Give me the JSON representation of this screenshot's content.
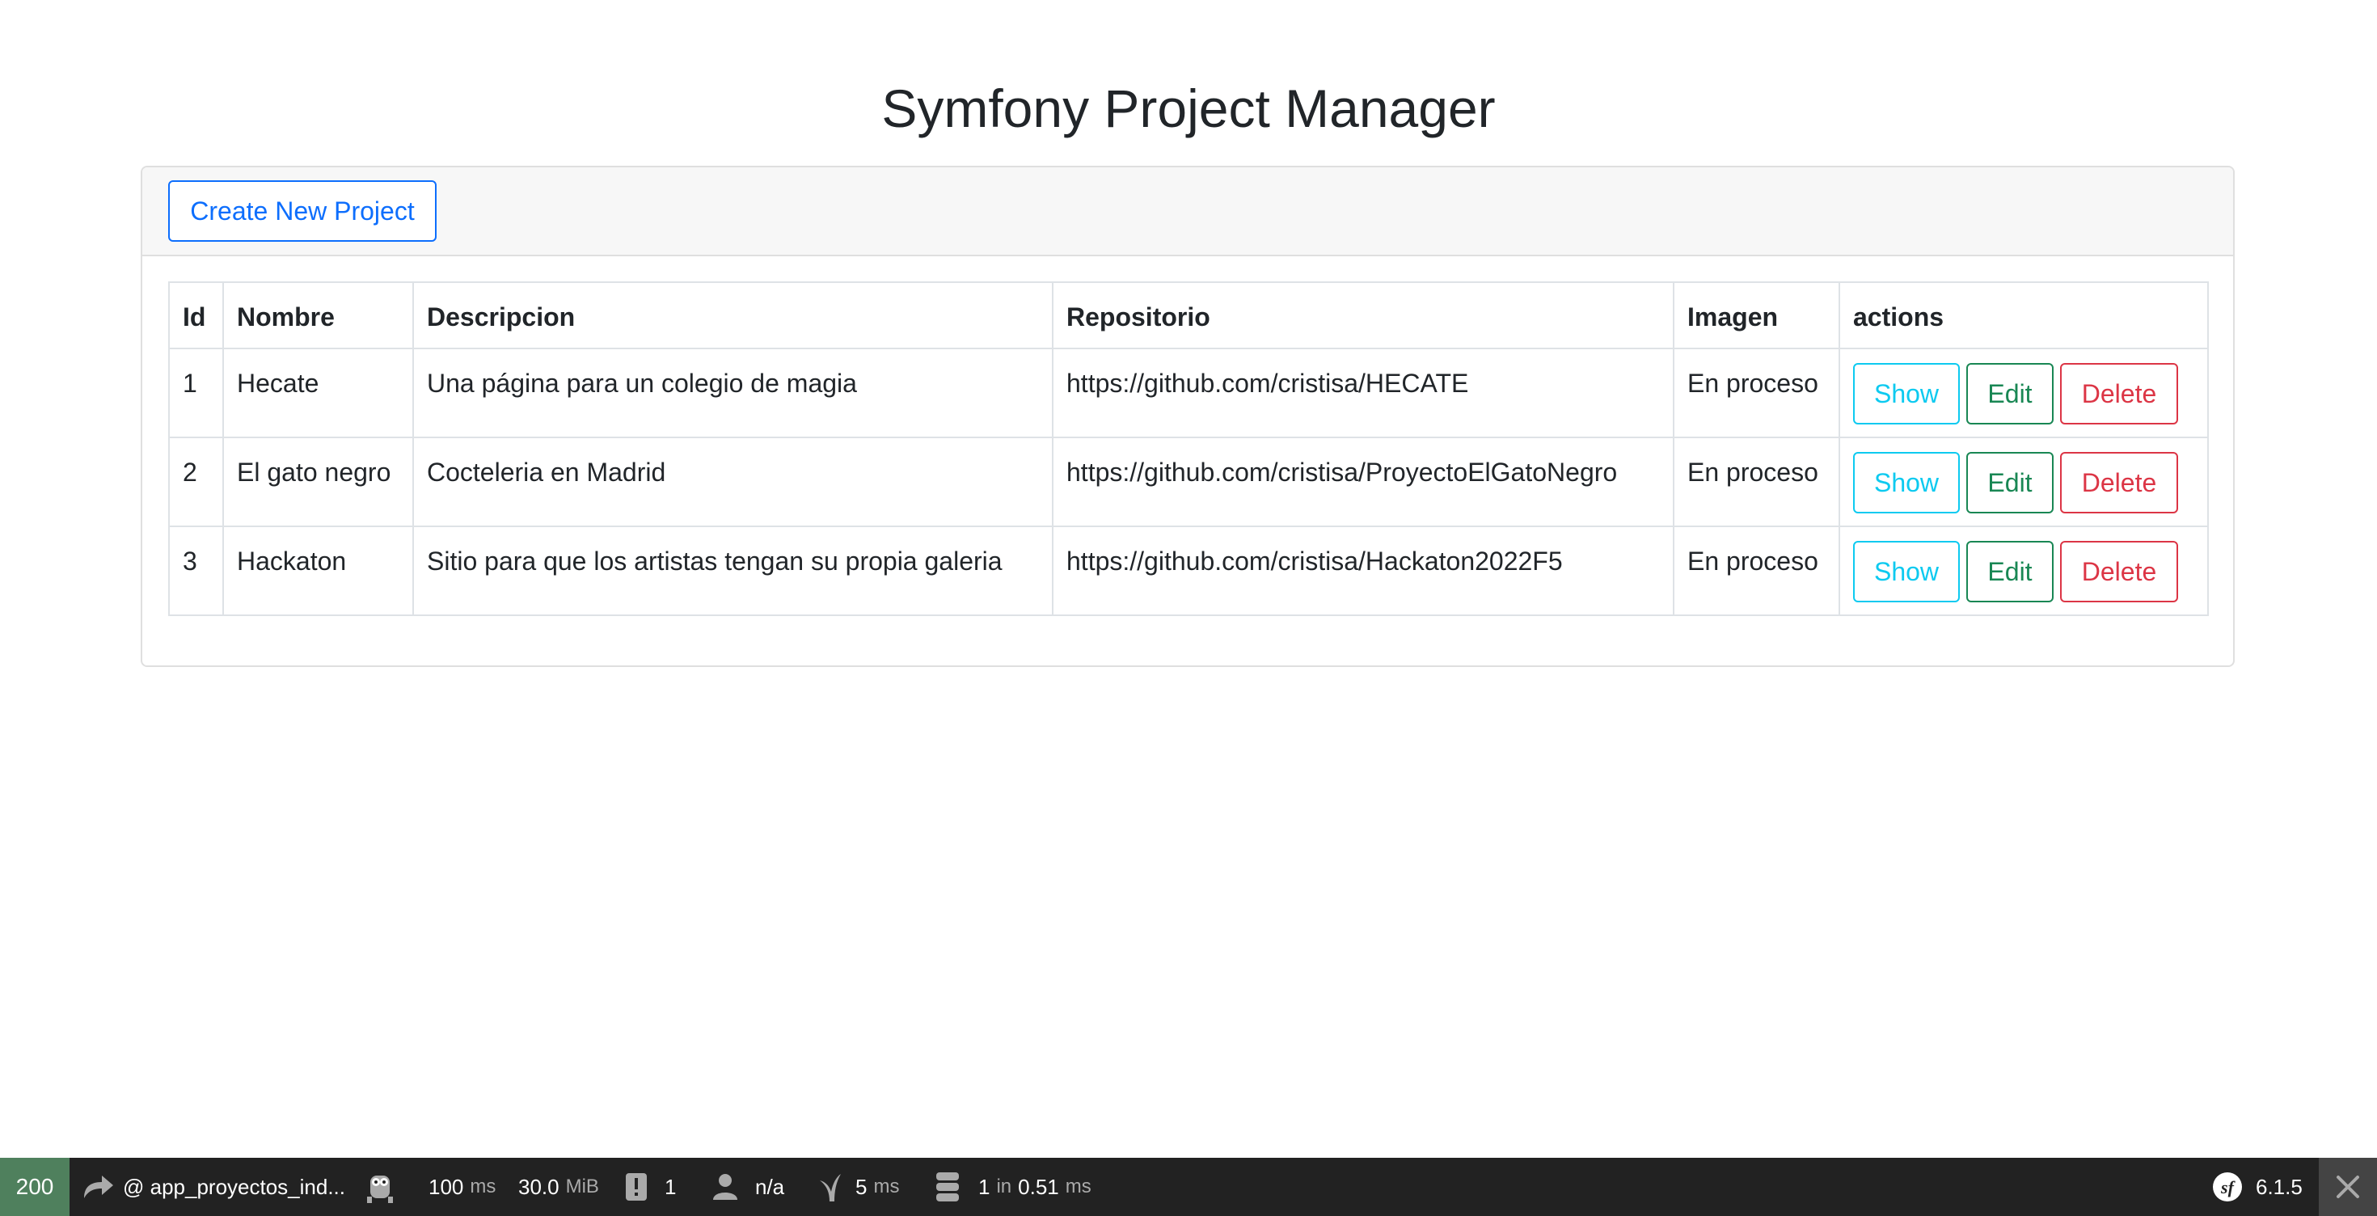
{
  "page": {
    "title": "Symfony Project Manager"
  },
  "actions": {
    "create_label": "Create New Project"
  },
  "table": {
    "headers": {
      "id": "Id",
      "nombre": "Nombre",
      "descripcion": "Descripcion",
      "repositorio": "Repositorio",
      "imagen": "Imagen",
      "actions": "actions"
    },
    "rows": [
      {
        "id": "1",
        "nombre": "Hecate",
        "descripcion": "Una página para un colegio de magia",
        "repositorio": "https://github.com/cristisa/HECATE",
        "imagen": "En proceso"
      },
      {
        "id": "2",
        "nombre": "El gato negro",
        "descripcion": "Cocteleria en Madrid",
        "repositorio": "https://github.com/cristisa/ProyectoElGatoNegro",
        "imagen": "En proceso"
      },
      {
        "id": "3",
        "nombre": "Hackaton",
        "descripcion": "Sitio para que los artistas tengan su propia galeria",
        "repositorio": "https://github.com/cristisa/Hackaton2022F5",
        "imagen": "En proceso"
      }
    ],
    "row_actions": {
      "show": "Show",
      "edit": "Edit",
      "delete": "Delete"
    }
  },
  "colors": {
    "primary": "#0d6efd",
    "info": "#0dcaf0",
    "success": "#198754",
    "danger": "#dc3545",
    "toolbar_bg": "#222222",
    "status_ok": "#4f805d"
  },
  "toolbar": {
    "status_code": "200",
    "route": "@ app_proyectos_ind...",
    "time_value": "100",
    "time_unit": "ms",
    "memory_value": "30.0",
    "memory_unit": "MiB",
    "forms_count": "1",
    "user": "n/a",
    "twig_value": "5",
    "twig_unit": "ms",
    "db_queries": "1",
    "db_in": "in",
    "db_time": "0.51",
    "db_unit": "ms",
    "version": "6.1.5",
    "icons": [
      "redirect-arrow-icon",
      "ajax-icon",
      "forms-icon",
      "user-icon",
      "twig-icon",
      "database-icon",
      "symfony-logo-icon",
      "close-icon"
    ]
  }
}
